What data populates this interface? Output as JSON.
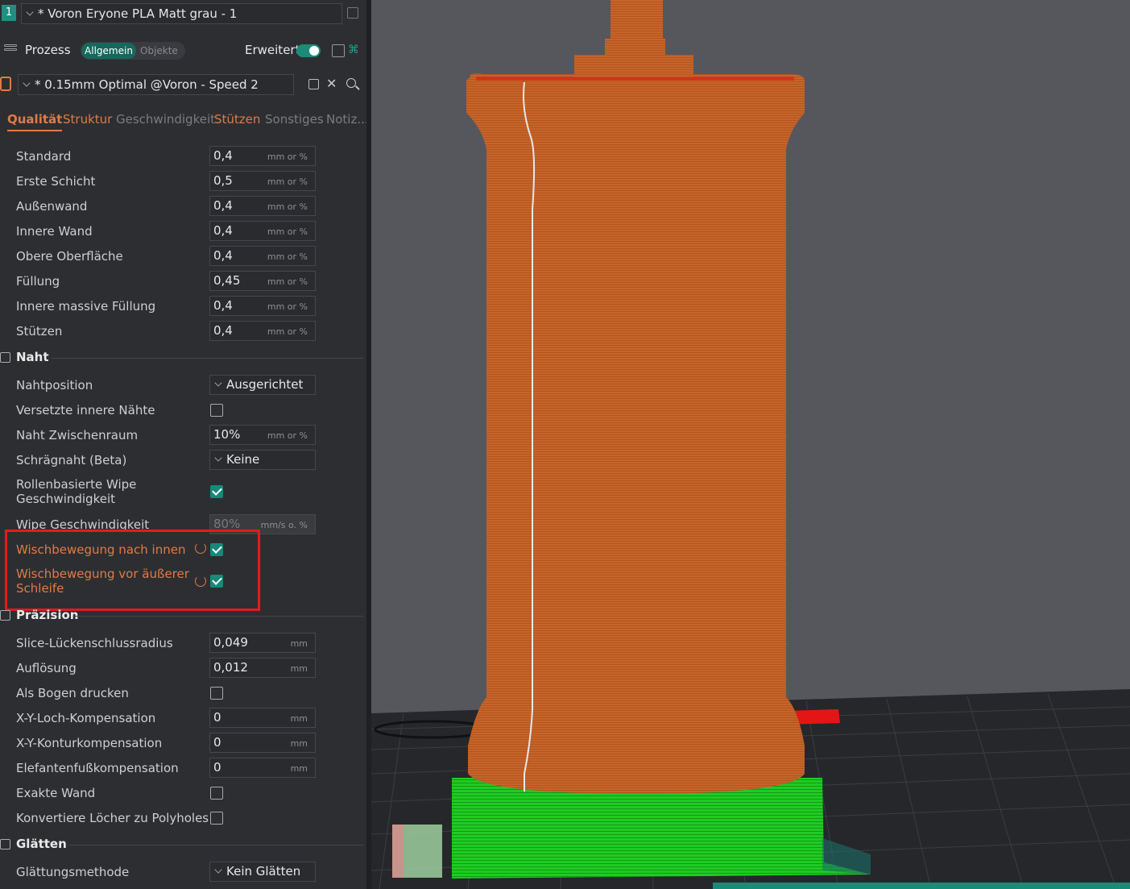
{
  "filament": {
    "index": "1",
    "name": "* Voron Eryone PLA Matt grau - 1"
  },
  "process": {
    "label": "Prozess",
    "mode_on": "Allgemein",
    "mode_off": "Objekte",
    "advanced_label": "Erweitert",
    "preset": "* 0.15mm Optimal @Voron - Speed 2"
  },
  "tabs": [
    "Qualität",
    "Struktur",
    "Geschwindigkeit",
    "Stützen",
    "Sonstiges",
    "Notiz..."
  ],
  "line_width": [
    {
      "label": "Standard",
      "value": "0,4",
      "unit": "mm or %"
    },
    {
      "label": "Erste Schicht",
      "value": "0,5",
      "unit": "mm or %"
    },
    {
      "label": "Außenwand",
      "value": "0,4",
      "unit": "mm or %"
    },
    {
      "label": "Innere Wand",
      "value": "0,4",
      "unit": "mm or %"
    },
    {
      "label": "Obere Oberfläche",
      "value": "0,4",
      "unit": "mm or %"
    },
    {
      "label": "Füllung",
      "value": "0,45",
      "unit": "mm or %"
    },
    {
      "label": "Innere massive Füllung",
      "value": "0,4",
      "unit": "mm or %"
    },
    {
      "label": "Stützen",
      "value": "0,4",
      "unit": "mm or %"
    }
  ],
  "seam": {
    "title": "Naht",
    "position_label": "Nahtposition",
    "position_value": "Ausgerichtet",
    "staggered_label": "Versetzte innere Nähte",
    "gap_label": "Naht Zwischenraum",
    "gap_value": "10%",
    "gap_unit": "mm or %",
    "scarf_label": "Schrägnaht (Beta)",
    "scarf_value": "Keine",
    "roll_wipe_label_1": "Rollenbasierte Wipe",
    "roll_wipe_label_2": "Geschwindigkeit",
    "wipe_speed_label": "Wipe Geschwindigkeit",
    "wipe_speed_value": "80%",
    "wipe_speed_unit": "mm/s o. %",
    "wipe_inward_label": "Wischbewegung nach innen",
    "wipe_before_label_1": "Wischbewegung vor äußerer",
    "wipe_before_label_2": "Schleife"
  },
  "precision": {
    "title": "Präzision",
    "rows": [
      {
        "label": "Slice-Lückenschlussradius",
        "value": "0,049",
        "unit": "mm"
      },
      {
        "label": "Auflösung",
        "value": "0,012",
        "unit": "mm"
      }
    ],
    "arc_label": "Als Bogen drucken",
    "rows2": [
      {
        "label": "X-Y-Loch-Kompensation",
        "value": "0",
        "unit": "mm"
      },
      {
        "label": "X-Y-Konturkompensation",
        "value": "0",
        "unit": "mm"
      },
      {
        "label": "Elefantenfußkompensation",
        "value": "0",
        "unit": "mm"
      }
    ],
    "exact_wall_label": "Exakte Wand",
    "polyholes_label": "Konvertiere Löcher zu Polyholes"
  },
  "smoothing": {
    "title": "Glätten",
    "method_label": "Glättungsmethode",
    "method_value": "Kein Glätten"
  },
  "colors": {
    "accent": "#e07b45",
    "teal": "#158a78",
    "highlight": "#e31c1c",
    "model": "#c6642a",
    "support": "#19c21c"
  }
}
